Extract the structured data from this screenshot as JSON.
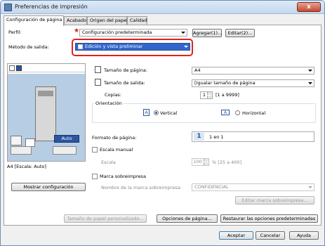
{
  "window": {
    "title": "Preferencias de impresión",
    "close_glyph": "x"
  },
  "tabs": [
    "Configuración de página",
    "Acabado",
    "Origen del papel",
    "Calidad"
  ],
  "perfil": {
    "label": "Perfil:",
    "value": "Configuración predeterminada",
    "add": "Agregar(1)...",
    "edit": "Editar(2)..."
  },
  "metodo": {
    "label": "Método de salida:",
    "value": "Edición y vista preliminar"
  },
  "preview": {
    "caption": "A4 [Escala: Auto]",
    "auto": "Auto",
    "show_button": "Mostrar configuración"
  },
  "page": {
    "size_label": "Tamaño de página:",
    "size_value": "A4",
    "output_label": "Tamaño de salida:",
    "output_value": "[Igualar tamaño de página",
    "copies_label": "Copias:",
    "copies_value": "1",
    "copies_range": "[1 a 9999]",
    "orient_label": "Orientación",
    "portrait": "Vertical",
    "landscape": "Horizontal",
    "format_label": "Formato de página:",
    "format_icon": "1",
    "format_value": "1 en 1",
    "manual_scale": "Escala manual",
    "scale_label": "Escala",
    "scale_value": "100",
    "scale_range": "% [25 a 400]",
    "watermark": "Marca sobreimpresa",
    "watermark_name_label": "Nombre de la marca sobreimpresa:",
    "watermark_value": "CONFIDENCIAL",
    "edit_watermark": "Editar marca sobreimpresa..."
  },
  "bottom": {
    "custom": "Tamaño de papel personalizado...",
    "page_options": "Opciones de página...",
    "restore": "Restaurar las opciones predeterminadas"
  },
  "dialog": {
    "ok": "Aceptar",
    "cancel": "Cancelar",
    "help": "Ayuda"
  },
  "colors": {
    "highlight": "#e02020",
    "selection": "#3366cc",
    "accent": "#2a55a0"
  }
}
